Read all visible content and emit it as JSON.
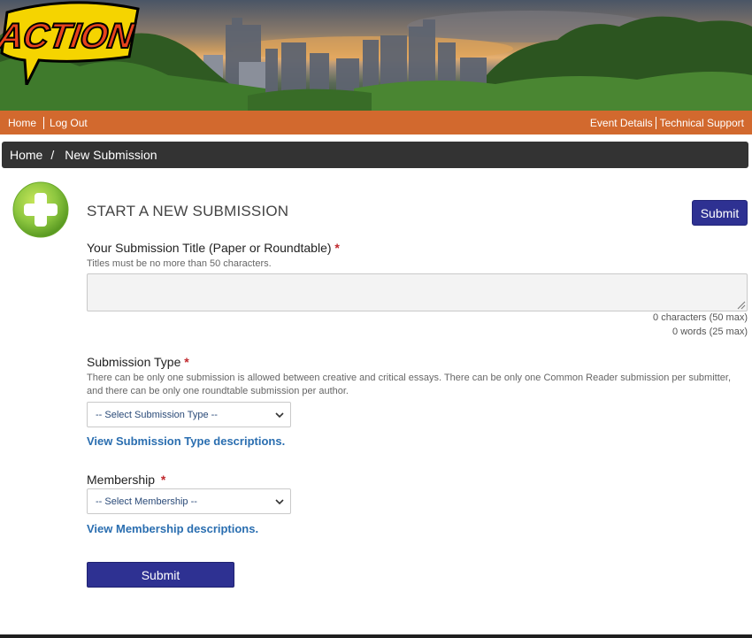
{
  "logo_text": "ACTION",
  "topnav": {
    "home": "Home",
    "logout": "Log Out",
    "event_details": "Event Details",
    "tech_support": "Technical Support"
  },
  "breadcrumb": {
    "home": "Home",
    "separator": "/",
    "current": "New Submission"
  },
  "page": {
    "title": "START A NEW SUBMISSION",
    "submit_top": "Submit",
    "submit_bottom": "Submit"
  },
  "fields": {
    "title": {
      "label": "Your Submission Title (Paper or Roundtable)",
      "required_mark": "*",
      "hint": "Titles must be no more than 50 characters.",
      "value": "",
      "char_counter": "0 characters (50 max)",
      "word_counter": "0 words (25 max)"
    },
    "submission_type": {
      "label": "Submission Type",
      "required_mark": "*",
      "hint": "There can be only one submission is allowed between creative and critical essays. There can be only one Common Reader submission per submitter, and there can be only one roundtable submission per author.",
      "selected": "-- Select Submission Type --",
      "link": "View Submission Type descriptions."
    },
    "membership": {
      "label": "Membership",
      "required_mark": "*",
      "selected": "-- Select Membership --",
      "link": "View Membership descriptions."
    }
  },
  "colors": {
    "nav_orange": "#d2692e",
    "breadcrumb_bg": "#333333",
    "button_blue": "#2e3192",
    "link_blue": "#2a6eb0",
    "required_red": "#c0282d"
  },
  "icons": {
    "add": "plus-circle-icon",
    "select_arrow": "chevron-down-icon",
    "resize": "resize-grip-icon"
  }
}
